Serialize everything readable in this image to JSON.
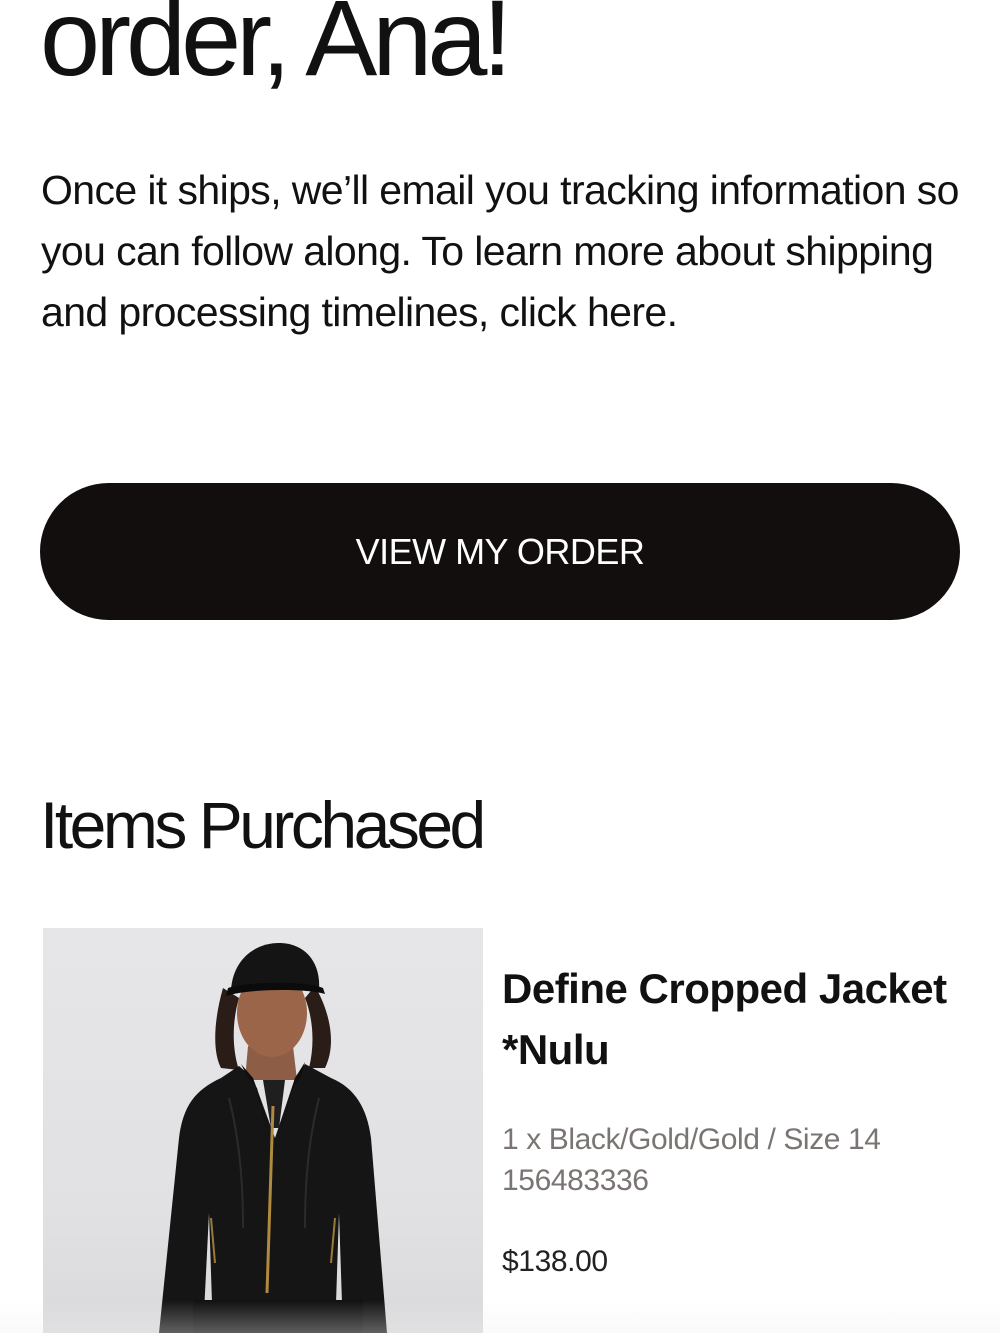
{
  "header": {
    "headline": "order, Ana!"
  },
  "intro": {
    "text": "Once it ships, we’ll email you tracking information so you can follow along. To learn more about shipping and processing timelines, ",
    "link_label": "click here",
    "suffix": "."
  },
  "cta": {
    "label": "VIEW MY ORDER"
  },
  "items_section": {
    "title": "Items Purchased",
    "items": [
      {
        "name": "Define Cropped Jacket *Nulu",
        "variant": "1 x Black/Gold/Gold / Size 14",
        "sku": "156483336",
        "price": "$138.00",
        "image_alt": "black-cropped-zip-jacket-photo"
      }
    ]
  },
  "colors": {
    "button_bg": "#120e0e",
    "button_text": "#ffffff",
    "text_primary": "#111111",
    "text_secondary": "#7a7472",
    "image_bg": "#e3e3e5"
  }
}
